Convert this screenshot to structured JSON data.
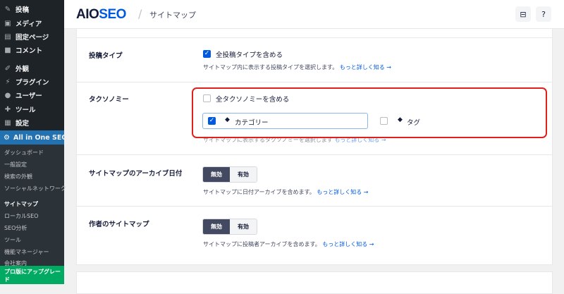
{
  "sidebar": {
    "items": [
      {
        "label": "投稿",
        "icon": "pin-icon"
      },
      {
        "label": "メディア",
        "icon": "media-icon"
      },
      {
        "label": "固定ページ",
        "icon": "page-icon"
      },
      {
        "label": "コメント",
        "icon": "comment-icon"
      },
      {
        "label": "外観",
        "icon": "brush-icon"
      },
      {
        "label": "プラグイン",
        "icon": "plugin-icon"
      },
      {
        "label": "ユーザー",
        "icon": "user-icon"
      },
      {
        "label": "ツール",
        "icon": "wrench-icon"
      },
      {
        "label": "設定",
        "icon": "settings-icon"
      },
      {
        "label": "All in One SEO",
        "icon": "aioseo-icon"
      }
    ],
    "submenu": [
      "ダッシュボード",
      "一般設定",
      "検索の外観",
      "ソーシャルネットワーク",
      "サイトマップ",
      "ローカルSEO",
      "SEO分析",
      "ツール",
      "機能マネージャー",
      "会社案内"
    ],
    "upgrade": "プロ版にアップグレード"
  },
  "header": {
    "logo_a": "AIO",
    "logo_b": "SEO",
    "divider": "/",
    "title": "サイトマップ"
  },
  "rows": {
    "post_types": {
      "label": "投稿タイプ",
      "checkbox": "全投稿タイプを含める",
      "help": "サイトマップ内に表示する投稿タイプを選択します。",
      "link": "もっと詳しく知る →"
    },
    "taxonomy": {
      "label": "タクソノミー",
      "checkbox": "全タクソノミーを含める",
      "category": "カテゴリー",
      "tag": "タグ",
      "help": "サイトマップに表示するタクソノミーを選択します",
      "link": "もっと詳しく知る →"
    },
    "archive_date": {
      "label": "サイトマップのアーカイブ日付",
      "off": "無効",
      "on": "有効",
      "help": "サイトマップに日付アーカイブを含めます。",
      "link": "もっと詳しく知る →"
    },
    "author": {
      "label": "作者のサイトマップ",
      "off": "無効",
      "on": "有効",
      "help": "サイトマップに投稿者アーカイブを含めます。",
      "link": "もっと詳しく知る →"
    }
  },
  "colors": {
    "accent": "#005ae0",
    "highlight": "#e0201b",
    "sidebar": "#1d2327",
    "active": "#2271b1",
    "upgrade": "#00aa63"
  }
}
